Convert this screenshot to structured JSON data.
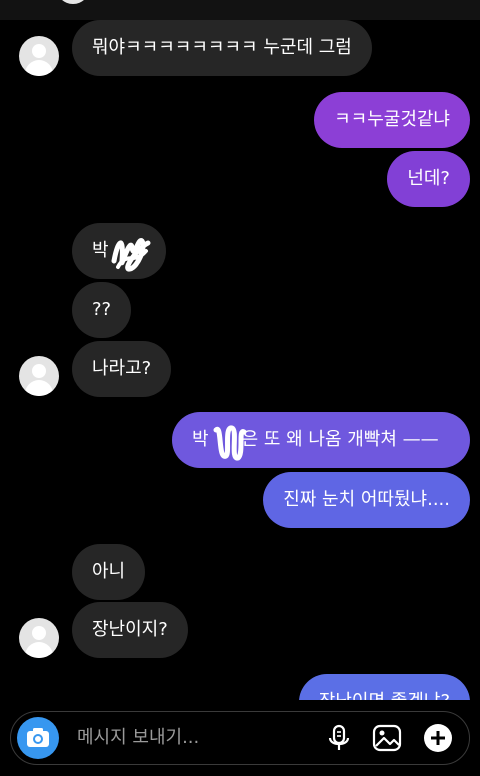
{
  "messages": [
    {
      "dir": "in",
      "text": "뭐야ㅋㅋㅋㅋㅋㅋㅋㅋ 누군데 그럼"
    },
    {
      "dir": "out",
      "text": "ㅋㅋ누굴것같냐"
    },
    {
      "dir": "out",
      "text": "넌데?"
    },
    {
      "dir": "in",
      "text": "박"
    },
    {
      "dir": "in",
      "text": "??"
    },
    {
      "dir": "in",
      "text": "나라고?"
    },
    {
      "dir": "out",
      "text_before": "박",
      "text_after": "은 또 왜 나옴 개빡쳐 ——"
    },
    {
      "dir": "out",
      "text": "진짜 눈치 어따뒀냐...."
    },
    {
      "dir": "in",
      "text": "아니"
    },
    {
      "dir": "in",
      "text": "장난이지?"
    },
    {
      "dir": "out",
      "text": "장난이면 좋겠냐?"
    }
  ],
  "composer": {
    "placeholder": "메시지 보내기...",
    "icons": [
      "camera-icon",
      "microphone-icon",
      "gallery-icon",
      "add-icon"
    ]
  },
  "colors": {
    "incoming_bubble": "#262626",
    "outgoing_gradient": [
      "#8a3fd4",
      "#5b6fe6"
    ],
    "camera_button": "#3797f0"
  }
}
